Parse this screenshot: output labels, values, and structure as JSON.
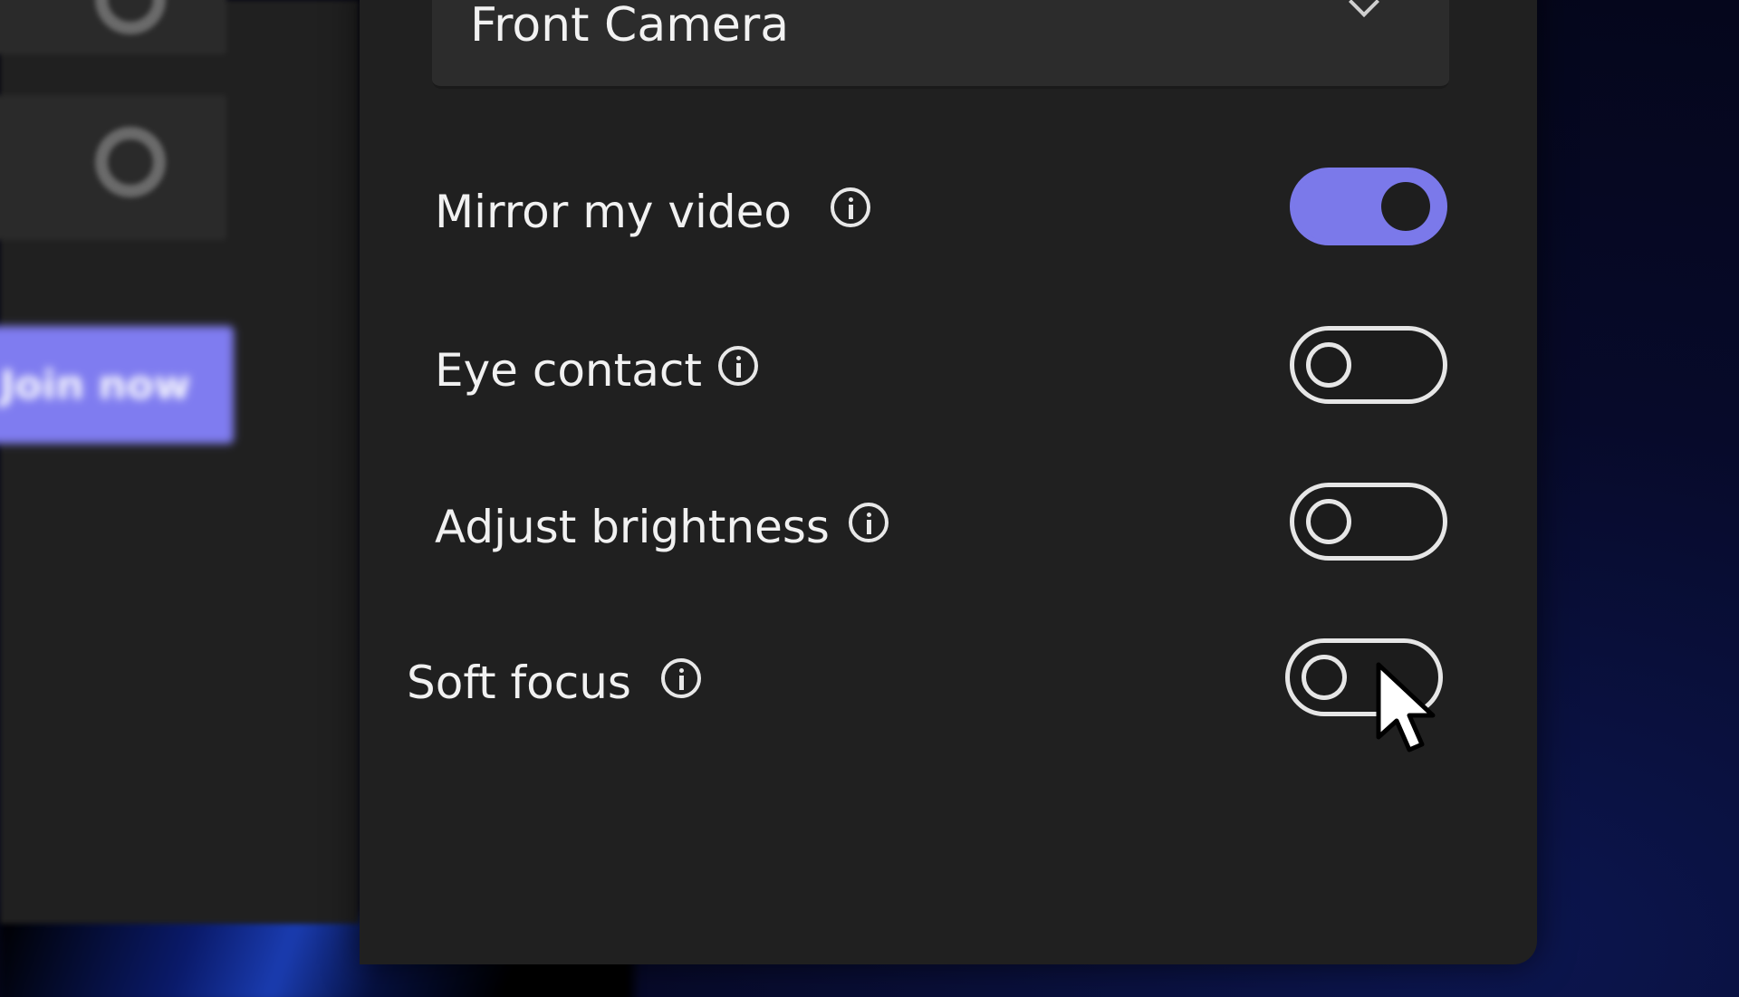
{
  "camera": {
    "selected_label": "Front Camera",
    "chevron_icon": "chevron-down-icon"
  },
  "join": {
    "label": "Join now"
  },
  "settings": [
    {
      "id": "mirror",
      "label": "Mirror my video",
      "enabled": true,
      "info_icon": "info-icon"
    },
    {
      "id": "eye-contact",
      "label": "Eye contact",
      "enabled": false,
      "info_icon": "info-icon"
    },
    {
      "id": "brightness",
      "label": "Adjust brightness",
      "enabled": false,
      "info_icon": "info-icon"
    },
    {
      "id": "soft-focus",
      "label": "Soft focus",
      "enabled": false,
      "info_icon": "info-icon"
    }
  ],
  "colors": {
    "accent": "#7b79ea",
    "panel": "#202020",
    "text": "#f1f1f1"
  }
}
